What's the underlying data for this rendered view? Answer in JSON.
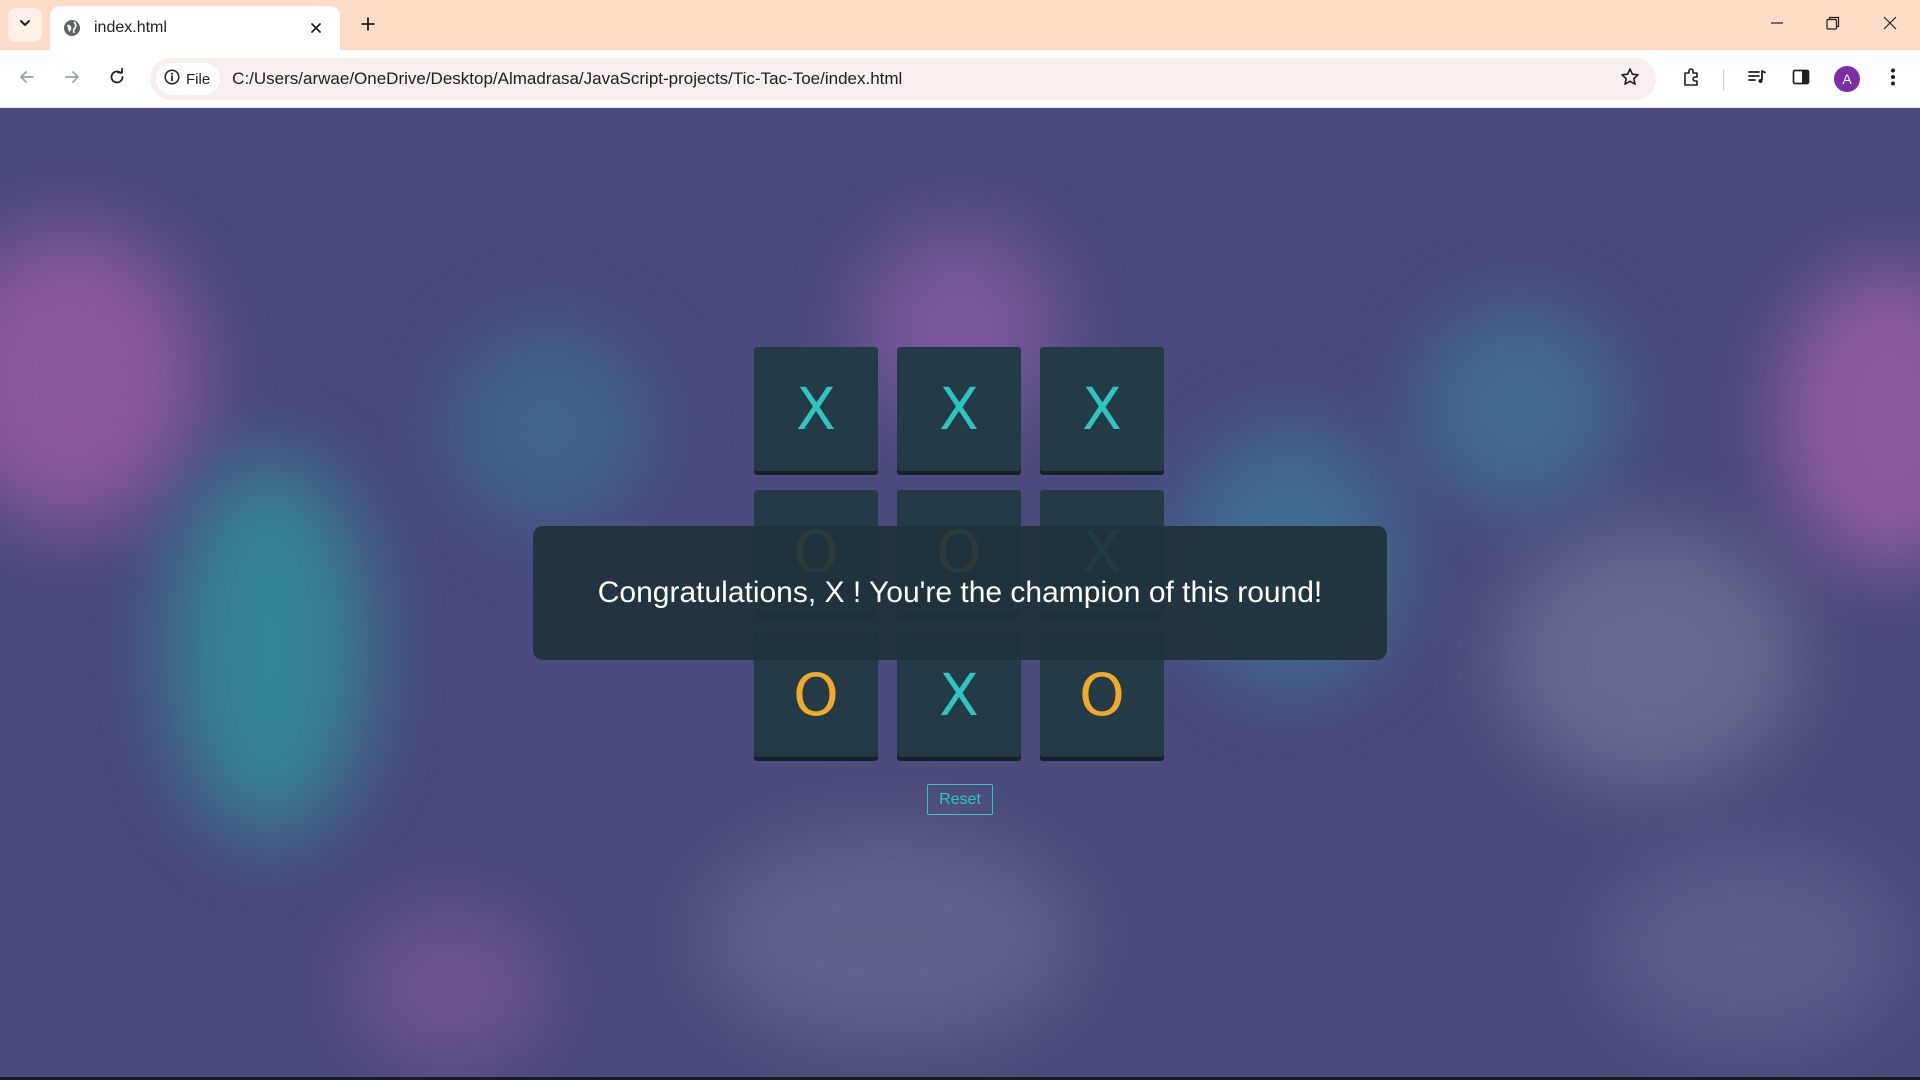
{
  "browser": {
    "tab": {
      "title": "index.html",
      "favicon_icon": "globe-icon"
    },
    "site_chip_label": "File",
    "url": "C:/Users/arwae/OneDrive/Desktop/Almadrasa/JavaScript-projects/Tic-Tac-Toe/index.html",
    "profile_initial": "A",
    "colors": {
      "tabstrip": "#ffdcc8",
      "toolbar": "#ffffff",
      "omnibox": "#f6efed",
      "avatar": "#7b2ea6"
    }
  },
  "game": {
    "board": [
      [
        "X",
        "X",
        "X"
      ],
      [
        "O",
        "O",
        "X"
      ],
      [
        "O",
        "X",
        "O"
      ]
    ],
    "message": "Congratulations, X ! You're the champion of this round!",
    "reset_label": "Reset",
    "colors": {
      "x": "#2ec6bc",
      "o": "#f0aa2a",
      "cell": "#243a47",
      "overlay": "#20323a"
    }
  }
}
